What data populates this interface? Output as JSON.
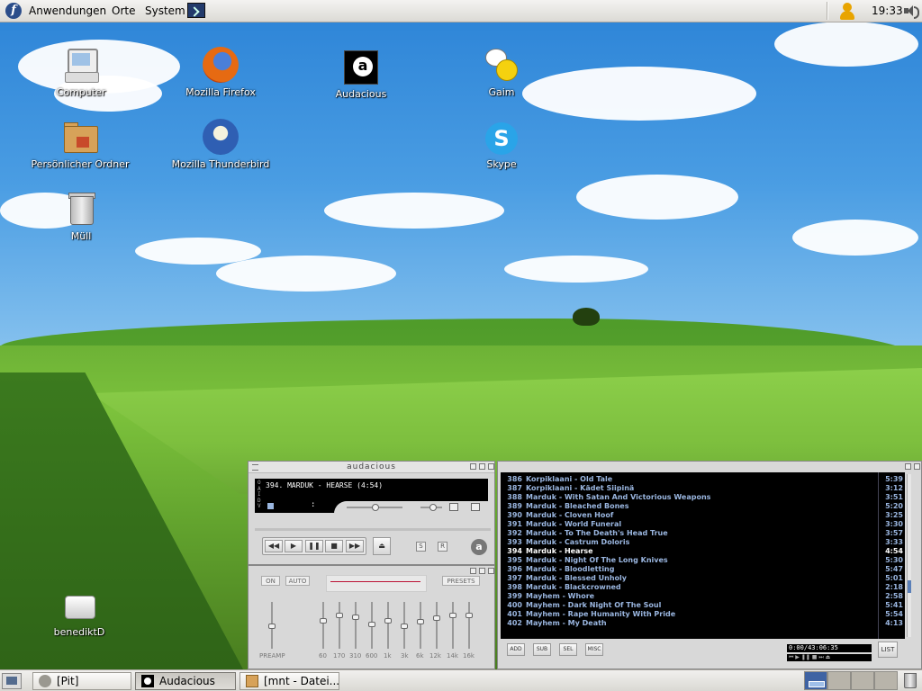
{
  "top_panel": {
    "menus": [
      "Anwendungen",
      "Orte",
      "System"
    ],
    "clock": "19:33"
  },
  "desktop": {
    "icons": [
      {
        "label": "Computer",
        "icon": "computer-icon"
      },
      {
        "label": "Mozilla Firefox",
        "icon": "firefox-icon"
      },
      {
        "label": "Audacious",
        "icon": "audacious-icon"
      },
      {
        "label": "Gaim",
        "icon": "gaim-icon"
      },
      {
        "label": "Persönlicher Ordner",
        "icon": "home-folder-icon"
      },
      {
        "label": "Mozilla Thunderbird",
        "icon": "thunderbird-icon"
      },
      {
        "label": "Skype",
        "icon": "skype-icon"
      },
      {
        "label": "Müll",
        "icon": "trash-icon"
      },
      {
        "label": "benediktD",
        "icon": "drive-icon"
      }
    ]
  },
  "player": {
    "title": "audacious",
    "song": "394. MARDUK - HEARSE (4:54)",
    "flags": [
      "O",
      "A",
      "I",
      "D",
      "V"
    ],
    "time_sep": ":",
    "stereo_label": "S",
    "repeat_label": "R",
    "logo": "a"
  },
  "equalizer": {
    "on_label": "ON",
    "auto_label": "AUTO",
    "presets_label": "PRESETS",
    "preamp_label": "PREAMP",
    "bands": [
      "60",
      "170",
      "310",
      "600",
      "1k",
      "3k",
      "6k",
      "12k",
      "14k",
      "16k"
    ]
  },
  "playlist": {
    "tracks": [
      {
        "num": "386",
        "title": "Korpiklaani - Old Tale",
        "duration": "5:39"
      },
      {
        "num": "387",
        "title": "Korpiklaani - Kädet Siipinä",
        "duration": "3:12"
      },
      {
        "num": "388",
        "title": "Marduk - With Satan And Victorious Weapons",
        "duration": "3:51"
      },
      {
        "num": "389",
        "title": "Marduk - Bleached Bones",
        "duration": "5:20"
      },
      {
        "num": "390",
        "title": "Marduk - Cloven Hoof",
        "duration": "3:25"
      },
      {
        "num": "391",
        "title": "Marduk - World Funeral",
        "duration": "3:30"
      },
      {
        "num": "392",
        "title": "Marduk - To The Death's Head True",
        "duration": "3:57"
      },
      {
        "num": "393",
        "title": "Marduk - Castrum Doloris",
        "duration": "3:33"
      },
      {
        "num": "394",
        "title": "Marduk - Hearse",
        "duration": "4:54",
        "current": true
      },
      {
        "num": "395",
        "title": "Marduk - Night Of The Long Knives",
        "duration": "5:30"
      },
      {
        "num": "396",
        "title": "Marduk - Bloodletting",
        "duration": "5:47"
      },
      {
        "num": "397",
        "title": "Marduk - Blessed Unholy",
        "duration": "5:01"
      },
      {
        "num": "398",
        "title": "Marduk - Blackcrowned",
        "duration": "2:18"
      },
      {
        "num": "399",
        "title": "Mayhem - Whore",
        "duration": "2:58"
      },
      {
        "num": "400",
        "title": "Mayhem - Dark Night Of The Soul",
        "duration": "5:41"
      },
      {
        "num": "401",
        "title": "Mayhem - Rape Humanity With Pride",
        "duration": "5:54"
      },
      {
        "num": "402",
        "title": "Mayhem - My Death",
        "duration": "4:13"
      }
    ],
    "buttons": [
      "ADD",
      "SUB",
      "SEL",
      "MISC"
    ],
    "time": "0:00/43:06:35",
    "list_label": "LIST"
  },
  "taskbar": {
    "tasks": [
      {
        "label": "[Pit]",
        "active": false
      },
      {
        "label": "Audacious",
        "active": true
      },
      {
        "label": "[mnt - Datei...",
        "active": false
      }
    ]
  },
  "colors": {
    "playlist_text": "#9ab6e0",
    "playlist_current": "#ffffff",
    "workspace_active": "#3f63a3"
  }
}
